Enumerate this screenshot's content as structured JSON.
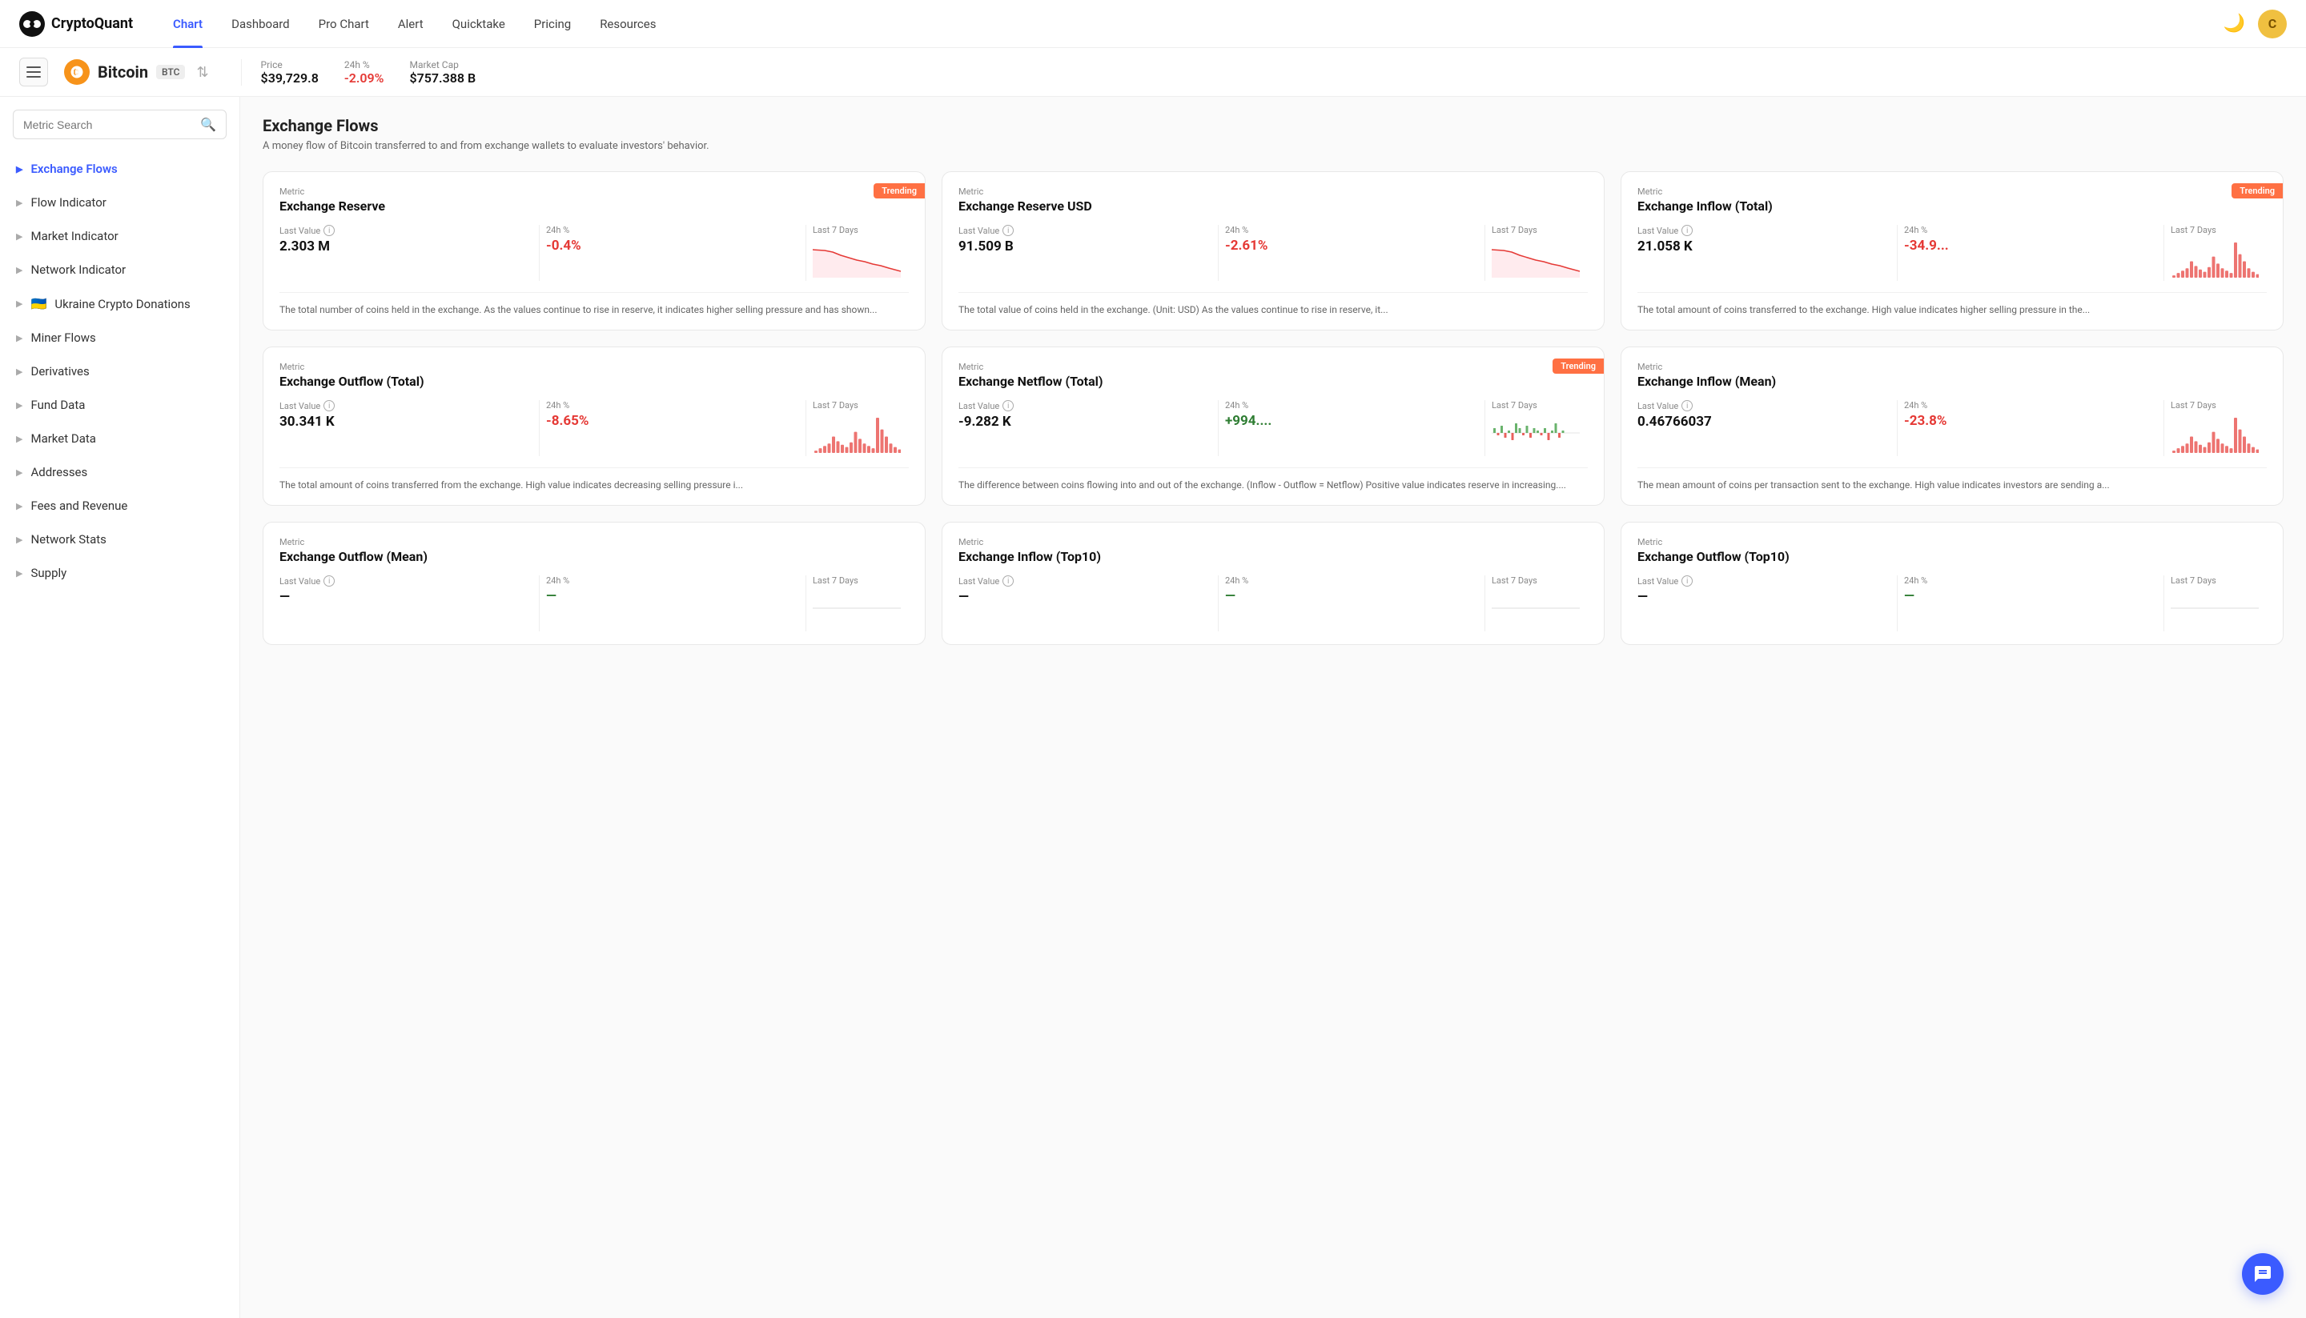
{
  "navbar": {
    "logo_text": "CryptoQuant",
    "links": [
      {
        "label": "Chart",
        "active": true
      },
      {
        "label": "Dashboard",
        "active": false
      },
      {
        "label": "Pro Chart",
        "active": false
      },
      {
        "label": "Alert",
        "active": false
      },
      {
        "label": "Quicktake",
        "active": false
      },
      {
        "label": "Pricing",
        "active": false
      },
      {
        "label": "Resources",
        "active": false
      }
    ],
    "user_initial": "C"
  },
  "coin_bar": {
    "coin_name": "Bitcoin",
    "coin_ticker": "BTC",
    "price_label": "Price",
    "price_value": "$39,729.8",
    "change_label": "24h %",
    "change_value": "-2.09%",
    "mcap_label": "Market Cap",
    "mcap_value": "$757.388 B"
  },
  "sidebar": {
    "search_placeholder": "Metric Search",
    "items": [
      {
        "label": "Exchange Flows",
        "active": true,
        "flag": null
      },
      {
        "label": "Flow Indicator",
        "active": false,
        "flag": null
      },
      {
        "label": "Market Indicator",
        "active": false,
        "flag": null
      },
      {
        "label": "Network Indicator",
        "active": false,
        "flag": null
      },
      {
        "label": "Ukraine Crypto Donations",
        "active": false,
        "flag": "🇺🇦"
      },
      {
        "label": "Miner Flows",
        "active": false,
        "flag": null
      },
      {
        "label": "Derivatives",
        "active": false,
        "flag": null
      },
      {
        "label": "Fund Data",
        "active": false,
        "flag": null
      },
      {
        "label": "Market Data",
        "active": false,
        "flag": null
      },
      {
        "label": "Addresses",
        "active": false,
        "flag": null
      },
      {
        "label": "Fees and Revenue",
        "active": false,
        "flag": null
      },
      {
        "label": "Network Stats",
        "active": false,
        "flag": null
      },
      {
        "label": "Supply",
        "active": false,
        "flag": null
      }
    ]
  },
  "content": {
    "section_title": "Exchange Flows",
    "section_desc": "A money flow of Bitcoin transferred to and from exchange wallets to evaluate investors' behavior.",
    "metrics": [
      {
        "label": "Metric",
        "name": "Exchange Reserve",
        "trending": true,
        "last_value_label": "Last Value",
        "last_value": "2.303 M",
        "change_label": "24h %",
        "change_value": "-0.4%",
        "change_negative": true,
        "chart_label": "Last 7 Days",
        "chart_type": "down",
        "desc": "The total number of coins held in the exchange. As the values continue to rise in reserve, it indicates higher selling pressure and has shown..."
      },
      {
        "label": "Metric",
        "name": "Exchange Reserve USD",
        "trending": false,
        "last_value_label": "Last Value",
        "last_value": "91.509 B",
        "change_label": "24h %",
        "change_value": "-2.61%",
        "change_negative": true,
        "chart_label": "Last 7 Days",
        "chart_type": "down",
        "desc": "The total value of coins held in the exchange. (Unit: USD) As the values continue to rise in reserve, it..."
      },
      {
        "label": "Metric",
        "name": "Exchange Inflow (Total)",
        "trending": true,
        "last_value_label": "Last Value",
        "last_value": "21.058 K",
        "change_label": "24h %",
        "change_value": "-34.9...",
        "change_negative": true,
        "chart_label": "Last 7 Days",
        "chart_type": "spike",
        "desc": "The total amount of coins transferred to the exchange. High value indicates higher selling pressure in the..."
      },
      {
        "label": "Metric",
        "name": "Exchange Outflow (Total)",
        "trending": false,
        "last_value_label": "Last Value",
        "last_value": "30.341 K",
        "change_label": "24h %",
        "change_value": "-8.65%",
        "change_negative": true,
        "chart_label": "Last 7 Days",
        "chart_type": "spike",
        "desc": "The total amount of coins transferred from the exchange. High value indicates decreasing selling pressure i..."
      },
      {
        "label": "Metric",
        "name": "Exchange Netflow (Total)",
        "trending": true,
        "last_value_label": "Last Value",
        "last_value": "-9.282 K",
        "change_label": "24h %",
        "change_value": "+994....",
        "change_negative": false,
        "chart_label": "Last 7 Days",
        "chart_type": "netflow",
        "desc": "The difference between coins flowing into and out of the exchange. (Inflow - Outflow = Netflow) Positive value indicates reserve in increasing...."
      },
      {
        "label": "Metric",
        "name": "Exchange Inflow (Mean)",
        "trending": false,
        "last_value_label": "Last Value",
        "last_value": "0.46766037",
        "change_label": "24h %",
        "change_value": "-23.8%",
        "change_negative": true,
        "chart_label": "Last 7 Days",
        "chart_type": "spike",
        "desc": "The mean amount of coins per transaction sent to the exchange. High value indicates investors are sending a..."
      },
      {
        "label": "Metric",
        "name": "Exchange Outflow (Mean)",
        "trending": false,
        "last_value_label": "Last Value",
        "last_value": "—",
        "change_label": "24h %",
        "change_value": "—",
        "change_negative": false,
        "chart_label": "Last 7 Days",
        "chart_type": "flat",
        "desc": ""
      },
      {
        "label": "Metric",
        "name": "Exchange Inflow (Top10)",
        "trending": false,
        "last_value_label": "Last Value",
        "last_value": "—",
        "change_label": "24h %",
        "change_value": "—",
        "change_negative": false,
        "chart_label": "Last 7 Days",
        "chart_type": "flat",
        "desc": ""
      },
      {
        "label": "Metric",
        "name": "Exchange Outflow (Top10)",
        "trending": false,
        "last_value_label": "Last Value",
        "last_value": "—",
        "change_label": "24h %",
        "change_value": "—",
        "change_negative": false,
        "chart_label": "Last 7 Days",
        "chart_type": "flat",
        "desc": ""
      }
    ]
  }
}
